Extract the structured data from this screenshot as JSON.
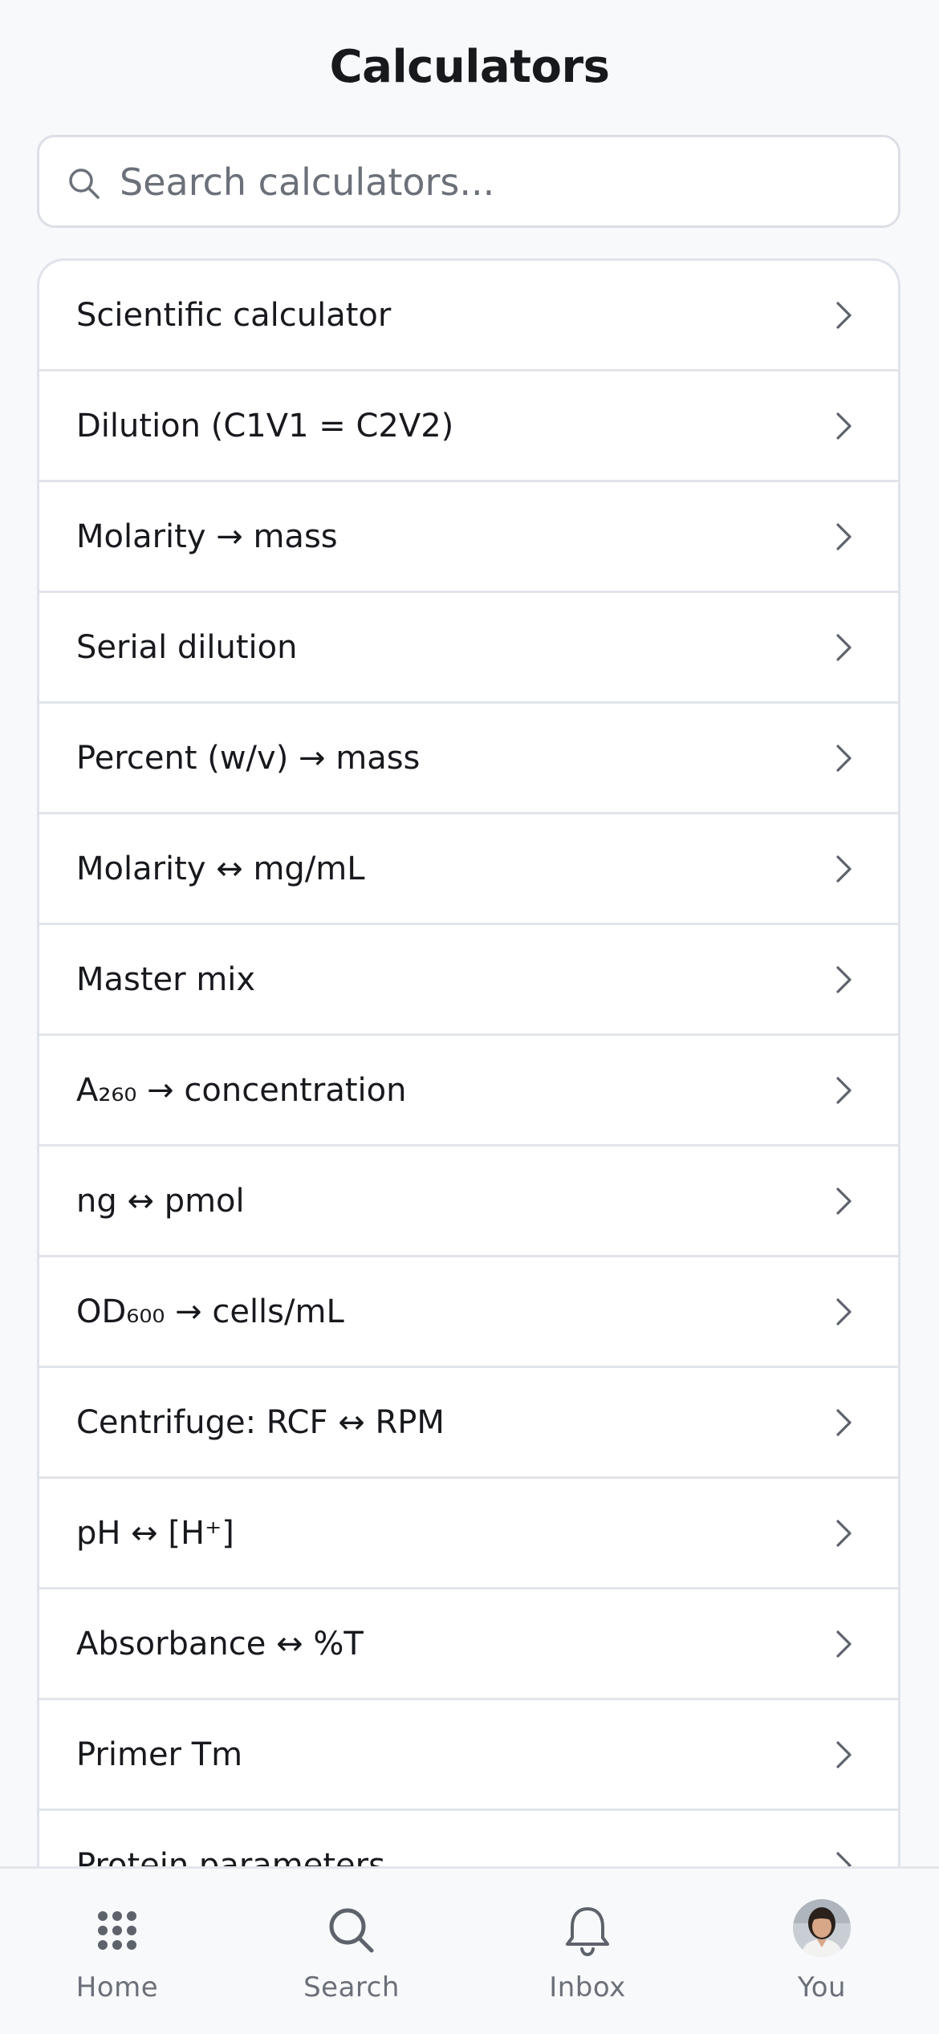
{
  "header": {
    "title": "Calculators"
  },
  "search": {
    "placeholder": "Search calculators...",
    "value": ""
  },
  "calculators": [
    {
      "label": "Scientific calculator"
    },
    {
      "label": "Dilution (C1V1 = C2V2)"
    },
    {
      "label": "Molarity → mass"
    },
    {
      "label": "Serial dilution"
    },
    {
      "label": "Percent (w/v) → mass"
    },
    {
      "label": "Molarity ↔ mg/mL"
    },
    {
      "label": "Master mix"
    },
    {
      "label": "A₂₆₀ → concentration"
    },
    {
      "label": "ng ↔ pmol"
    },
    {
      "label": "OD₆₀₀ → cells/mL"
    },
    {
      "label": "Centrifuge: RCF ↔ RPM"
    },
    {
      "label": "pH ↔ [H⁺]"
    },
    {
      "label": "Absorbance ↔ %T"
    },
    {
      "label": "Primer Tm"
    },
    {
      "label": "Protein parameters"
    }
  ],
  "tabbar": {
    "home": "Home",
    "search": "Search",
    "inbox": "Inbox",
    "you": "You"
  },
  "colors": {
    "background": "#f8f9fb",
    "text": "#17191d",
    "muted": "#6b7079",
    "border": "#e1e4ea"
  }
}
